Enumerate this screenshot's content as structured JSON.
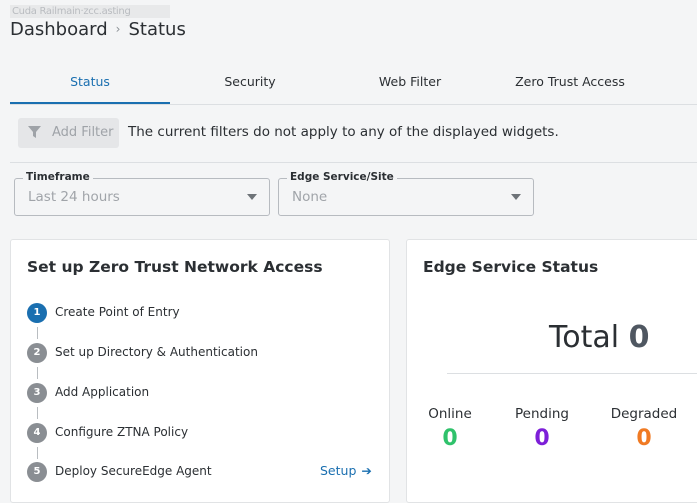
{
  "tenant_label": "Cuda Railmain·zcc.asting",
  "breadcrumb": {
    "root": "Dashboard",
    "separator": "›",
    "current": "Status"
  },
  "tabs": [
    {
      "label": "Status",
      "active": true
    },
    {
      "label": "Security",
      "active": false
    },
    {
      "label": "Web Filter",
      "active": false
    },
    {
      "label": "Zero Trust Access",
      "active": false
    }
  ],
  "filter": {
    "add_label": "Add Filter",
    "message": "The current filters do not apply to any of the displayed widgets."
  },
  "selects": {
    "timeframe": {
      "label": "Timeframe",
      "value": "Last 24 hours"
    },
    "edge": {
      "label": "Edge Service/Site",
      "value": "None"
    }
  },
  "ztna_card": {
    "title": "Set up Zero Trust Network Access",
    "steps": [
      {
        "num": "1",
        "label": "Create Point of Entry",
        "active": true
      },
      {
        "num": "2",
        "label": "Set up Directory & Authentication",
        "active": false
      },
      {
        "num": "3",
        "label": "Add Application",
        "active": false
      },
      {
        "num": "4",
        "label": "Configure ZTNA Policy",
        "active": false
      },
      {
        "num": "5",
        "label": "Deploy SecureEdge Agent",
        "active": false
      }
    ],
    "setup_label": "Setup"
  },
  "edge_card": {
    "title": "Edge Service Status",
    "total_label": "Total",
    "total_value": "0",
    "stats": [
      {
        "label": "Online",
        "value": "0",
        "color": "#2fc26b"
      },
      {
        "label": "Pending",
        "value": "0",
        "color": "#7d1fd8"
      },
      {
        "label": "Degraded",
        "value": "0",
        "color": "#f07a23"
      }
    ]
  }
}
